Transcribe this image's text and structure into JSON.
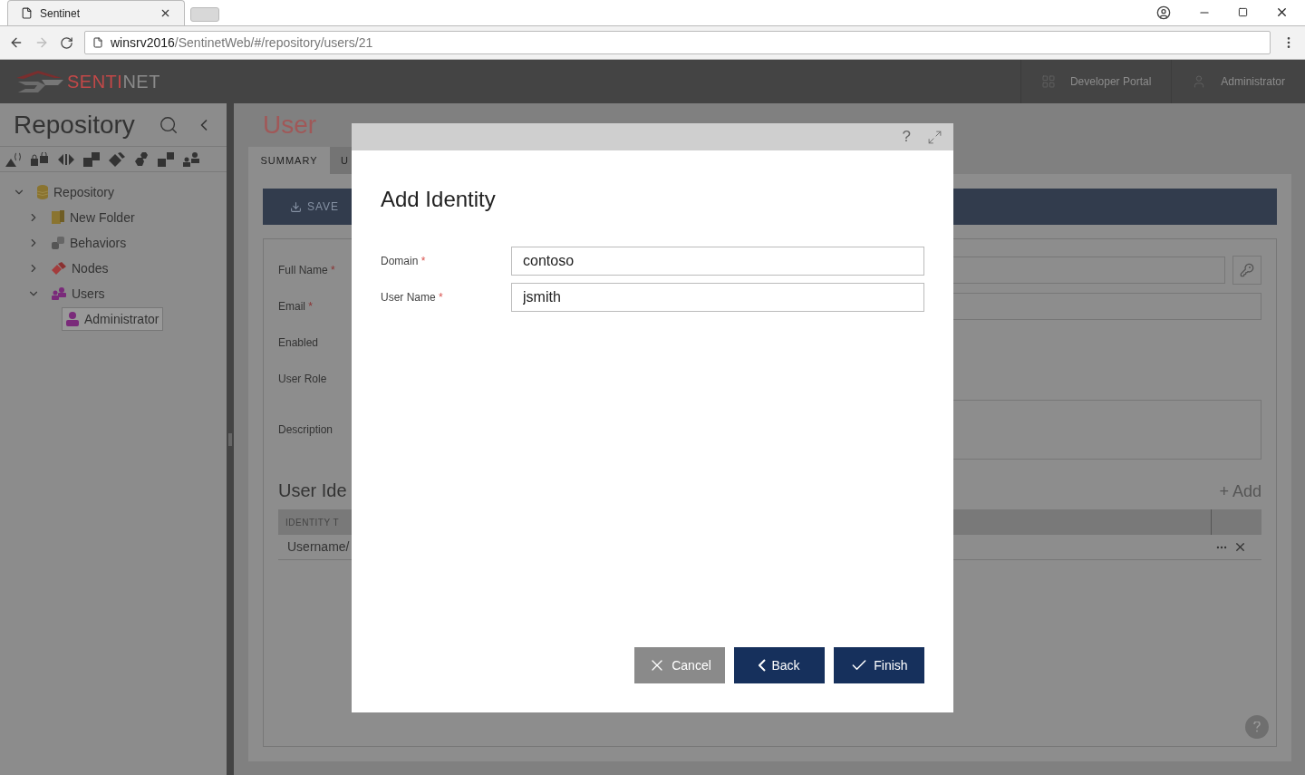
{
  "browser": {
    "tab_title": "Sentinet",
    "url_host": "winsrv2016",
    "url_path": "/SentinetWeb/#/repository/users/21"
  },
  "app_header": {
    "logo_left": "SENTI",
    "logo_right": "NET",
    "nav": [
      {
        "label": "Developer Portal",
        "kind": "grid"
      },
      {
        "label": "Administrator",
        "kind": "person"
      }
    ]
  },
  "sidebar": {
    "title": "Repository",
    "toolbar": [
      {
        "kind": "api"
      },
      {
        "kind": "lock"
      },
      {
        "kind": "arrows"
      },
      {
        "kind": "blocks"
      },
      {
        "kind": "diamond"
      },
      {
        "kind": "hexagons"
      },
      {
        "kind": "squares"
      },
      {
        "kind": "people"
      }
    ],
    "tree": [
      {
        "label": "Repository",
        "kind": "database",
        "expanded": true,
        "selected": false,
        "children": [
          {
            "label": "New Folder",
            "kind": "folder",
            "expanded": false,
            "selected": false
          },
          {
            "label": "Behaviors",
            "kind": "behaviors",
            "expanded": false,
            "selected": false
          },
          {
            "label": "Nodes",
            "kind": "nodes",
            "expanded": false,
            "selected": false
          },
          {
            "label": "Users",
            "kind": "users",
            "expanded": true,
            "selected": false,
            "children": [
              {
                "label": "Administrator",
                "kind": "user",
                "selected": true
              }
            ]
          }
        ]
      }
    ]
  },
  "page": {
    "title": "User",
    "tabs": [
      {
        "label": "SUMMARY",
        "selected": true
      },
      {
        "label": "U",
        "selected": false
      }
    ],
    "save_button": "SAVE",
    "form": [
      {
        "label": "Full Name",
        "required_mark": "*",
        "kind": "key-input"
      },
      {
        "label": "Email",
        "required_mark": "*",
        "kind": "input"
      },
      {
        "label": "Enabled",
        "kind": "blank"
      },
      {
        "label": "User Role",
        "kind": "blank"
      },
      {
        "label": "Description",
        "kind": "textarea"
      }
    ],
    "section_title": "User Ide",
    "add_link": "+ Add",
    "table": {
      "columns": [
        "IDENTITY T"
      ],
      "rows": [
        [
          "Username/"
        ]
      ]
    }
  },
  "dialog": {
    "title": "Add Identity",
    "help": "?",
    "fields": [
      {
        "label": "Domain",
        "required_mark": "*",
        "value": "contoso"
      },
      {
        "label": "User Name",
        "required_mark": "*",
        "value": "jsmith"
      }
    ],
    "buttons": [
      {
        "label": "Cancel",
        "kind": "cancel"
      },
      {
        "label": "Back",
        "kind": "back"
      },
      {
        "label": "Finish",
        "kind": "finish"
      }
    ]
  }
}
